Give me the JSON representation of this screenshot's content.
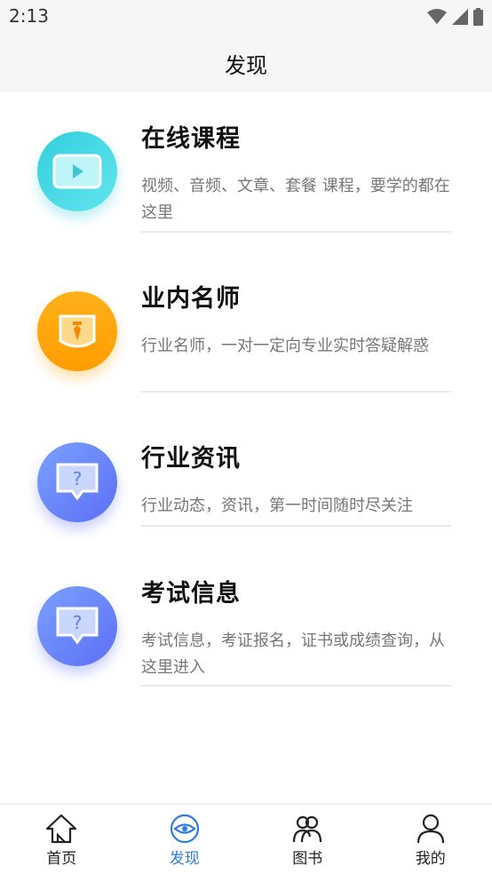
{
  "status": {
    "time": "2:13"
  },
  "header": {
    "title": "发现"
  },
  "items": [
    {
      "title": "在线课程",
      "desc": "视频、音频、文章、套餐 课程，要学的都在这里",
      "icon": "video-play-icon"
    },
    {
      "title": "业内名师",
      "desc": "行业名师，一对一定向专业实时答疑解惑",
      "icon": "teacher-badge-icon"
    },
    {
      "title": "行业资讯",
      "desc": "行业动态，资讯，第一时间随时尽关注",
      "icon": "question-bubble-icon"
    },
    {
      "title": "考试信息",
      "desc": "考试信息，考证报名，证书或成绩查询，从这里进入",
      "icon": "question-bubble-icon"
    }
  ],
  "tabs": [
    {
      "label": "首页",
      "icon": "home-icon",
      "active": false
    },
    {
      "label": "发现",
      "icon": "eye-icon",
      "active": true
    },
    {
      "label": "图书",
      "icon": "people-icon",
      "active": false
    },
    {
      "label": "我的",
      "icon": "user-icon",
      "active": false
    }
  ],
  "colors": {
    "accent": "#2e7be8",
    "teal": "#32cfdd",
    "orange": "#ffa80d",
    "blue": "#6a86fb"
  }
}
